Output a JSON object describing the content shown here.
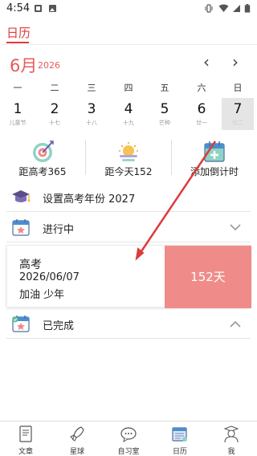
{
  "status_bar": {
    "time": "4:54"
  },
  "top_tab": {
    "label": "日历"
  },
  "calendar": {
    "month": "6月",
    "year": "2026",
    "prev": "‹",
    "next": "›",
    "weekdays": [
      "一",
      "二",
      "三",
      "四",
      "五",
      "六",
      "日"
    ],
    "days": [
      {
        "num": "1",
        "lunar": "儿童节"
      },
      {
        "num": "2",
        "lunar": "十七"
      },
      {
        "num": "3",
        "lunar": "十八"
      },
      {
        "num": "4",
        "lunar": "十九"
      },
      {
        "num": "5",
        "lunar": "芒种"
      },
      {
        "num": "6",
        "lunar": "廿一"
      },
      {
        "num": "7",
        "lunar": "廿二"
      }
    ]
  },
  "stats": {
    "gaokao": "距高考365",
    "today": "距今天152",
    "add": "添加倒计时"
  },
  "set_year": {
    "label": "设置高考年份  2027"
  },
  "in_progress": {
    "label": "进行中"
  },
  "card": {
    "title": "高考",
    "date": "2026/06/07",
    "note": "加油 少年",
    "days": "152天"
  },
  "done": {
    "label": "已完成"
  },
  "bottom_nav": [
    "文章",
    "星球",
    "自习室",
    "日历",
    "我"
  ],
  "colors": {
    "accent": "#e03a3a",
    "badge": "#ef8c8a"
  }
}
